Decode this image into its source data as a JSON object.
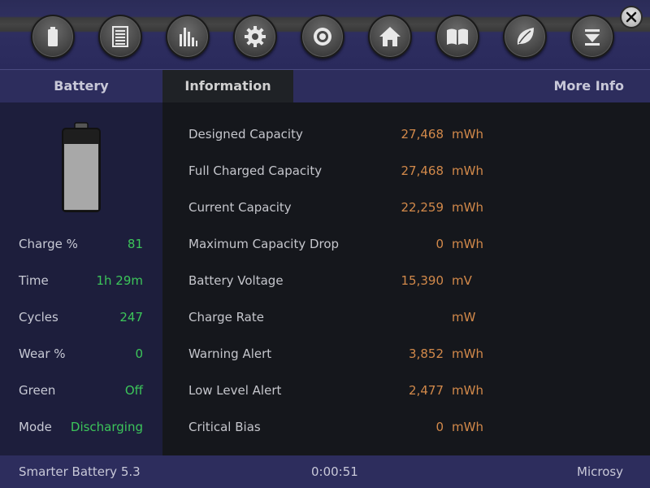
{
  "toolbar": {
    "buttons": [
      {
        "icon": "battery-icon"
      },
      {
        "icon": "list-icon"
      },
      {
        "icon": "bar-chart-icon"
      },
      {
        "icon": "gear-icon"
      },
      {
        "icon": "target-icon"
      },
      {
        "icon": "home-icon"
      },
      {
        "icon": "book-icon"
      },
      {
        "icon": "leaf-icon"
      },
      {
        "icon": "eject-down-icon"
      }
    ],
    "close_icon": "close-icon"
  },
  "tabs": {
    "battery": "Battery",
    "information": "Information",
    "more_info": "More Info"
  },
  "left": {
    "battery_charge_fraction": 0.81,
    "stats": [
      {
        "label": "Charge %",
        "value": "81"
      },
      {
        "label": "Time",
        "value": "1h 29m"
      },
      {
        "label": "Cycles",
        "value": "247"
      },
      {
        "label": "Wear %",
        "value": "0"
      },
      {
        "label": "Green",
        "value": "Off"
      },
      {
        "label": "Mode",
        "value": "Discharging"
      }
    ]
  },
  "info": {
    "rows": [
      {
        "label": "Designed Capacity",
        "value": "27,468",
        "unit": "mWh"
      },
      {
        "label": "Full Charged Capacity",
        "value": "27,468",
        "unit": "mWh"
      },
      {
        "label": "Current Capacity",
        "value": "22,259",
        "unit": "mWh"
      },
      {
        "label": "Maximum Capacity Drop",
        "value": "0",
        "unit": "mWh"
      },
      {
        "label": "Battery Voltage",
        "value": "15,390",
        "unit": "mV"
      },
      {
        "label": "Charge Rate",
        "value": "",
        "unit": "mW"
      },
      {
        "label": "Warning Alert",
        "value": "3,852",
        "unit": "mWh"
      },
      {
        "label": "Low Level Alert",
        "value": "2,477",
        "unit": "mWh"
      },
      {
        "label": "Critical Bias",
        "value": "0",
        "unit": "mWh"
      }
    ]
  },
  "status": {
    "app": "Smarter Battery 5.3",
    "time": "0:00:51",
    "right": "Microsy"
  },
  "colors": {
    "accent_green": "#3cc55a",
    "value_orange": "#d2894a",
    "panel_blue": "#2d2d5d"
  }
}
